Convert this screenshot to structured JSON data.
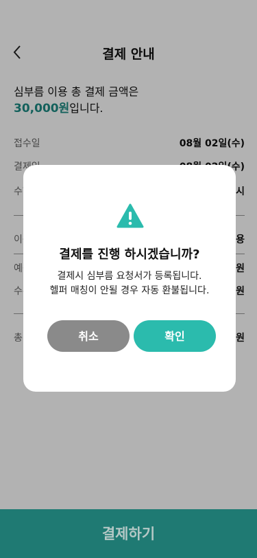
{
  "header": {
    "title": "결제 안내"
  },
  "summary": {
    "line1": "심부름 이용 총 결제 금액은",
    "amount": "30,000원",
    "suffix": "입니다."
  },
  "details": {
    "rows": [
      {
        "label": "접수일",
        "value": "08월 02일(수)"
      },
      {
        "label": "결제일",
        "value": "08월 02일(수)"
      },
      {
        "label": "수행",
        "value": "시"
      },
      {
        "label": "이용",
        "value": "용"
      },
      {
        "label": "예상",
        "value": "원"
      },
      {
        "label": "수수",
        "value": "원"
      },
      {
        "label": "총",
        "value": "원"
      }
    ]
  },
  "pay_button": {
    "label": "결제하기"
  },
  "modal": {
    "icon": "warning-icon",
    "title": "결제를 진행 하시겠습니까?",
    "message_line1": "결제시 심부름 요청서가 등록됩니다.",
    "message_line2": "헬퍼 매칭이 안될 경우 자동 환불됩니다.",
    "cancel_label": "취소",
    "confirm_label": "확인"
  },
  "colors": {
    "accent": "#2bbbad",
    "primary_dark": "#1f7a73",
    "cancel": "#8a8a8a"
  }
}
